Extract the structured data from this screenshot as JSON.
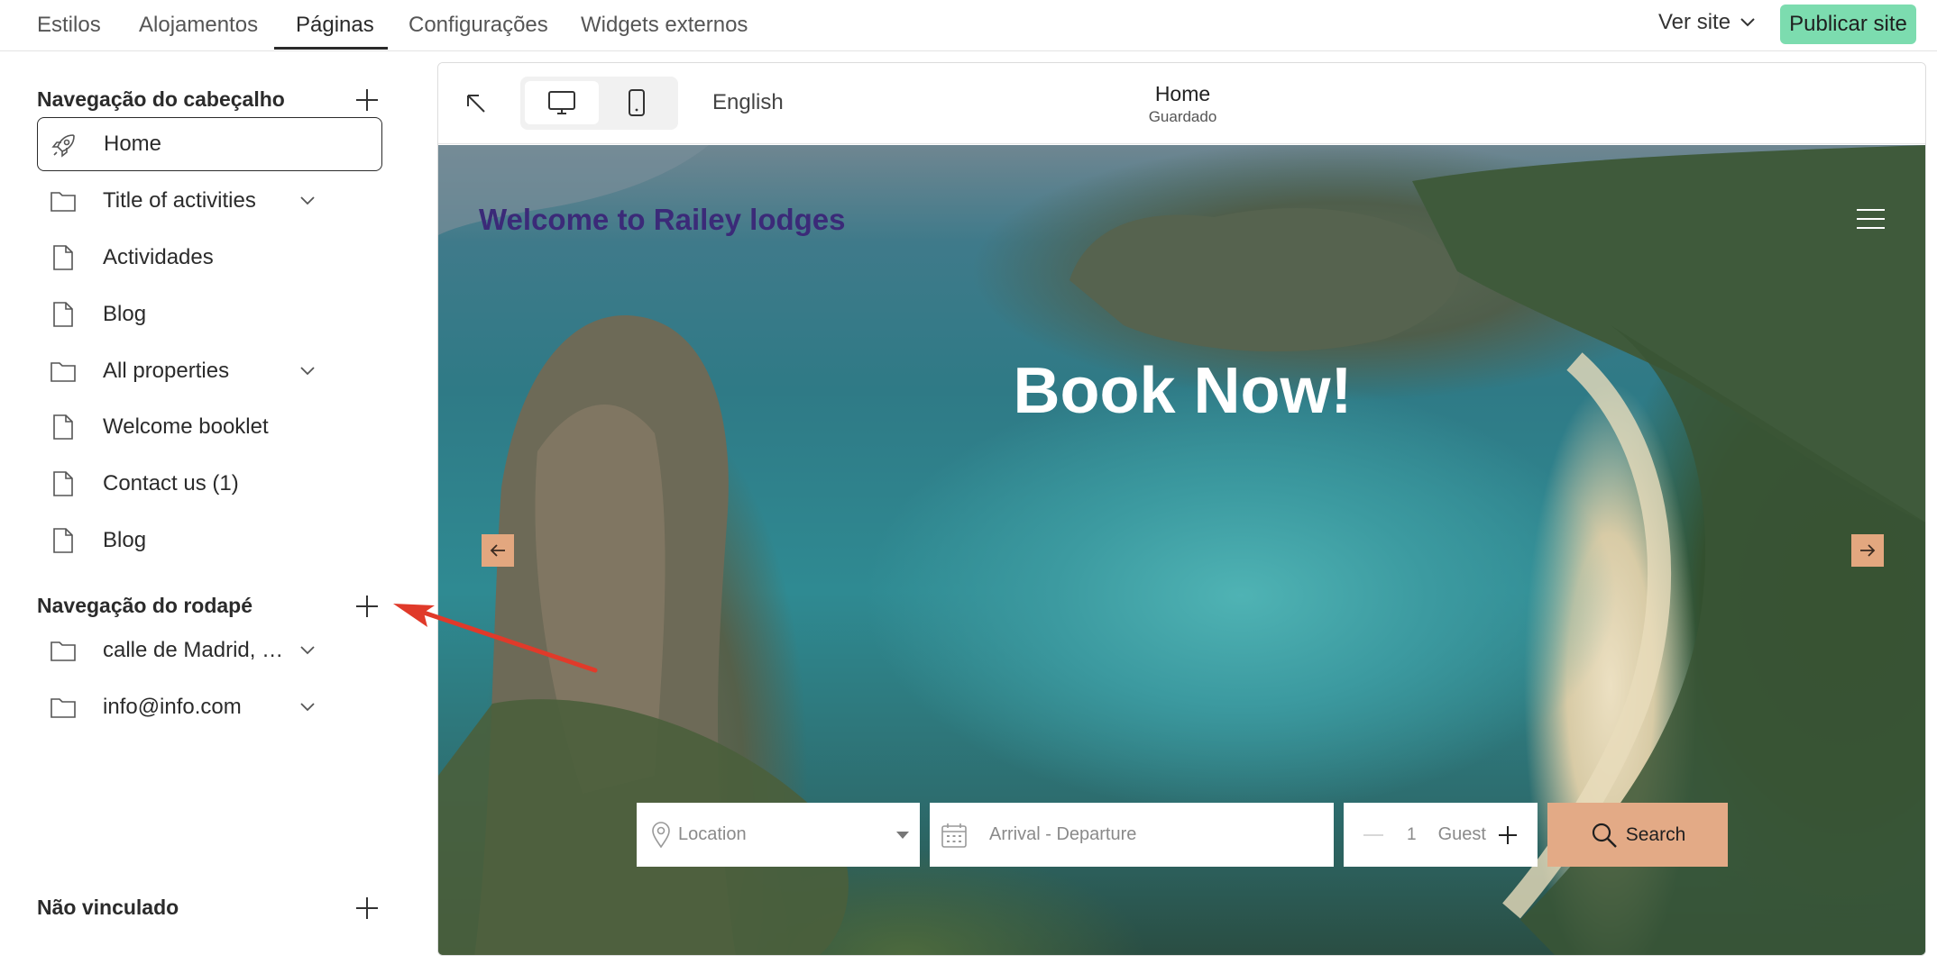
{
  "tabs": [
    {
      "label": "Estilos"
    },
    {
      "label": "Alojamentos"
    },
    {
      "label": "Páginas"
    },
    {
      "label": "Configurações"
    },
    {
      "label": "Widgets externos"
    }
  ],
  "header": {
    "view_site": "Ver site",
    "publish": "Publicar site"
  },
  "sidebar": {
    "header_nav": {
      "title": "Navegação do cabeçalho",
      "items": [
        {
          "label": "Home",
          "icon": "rocket-icon"
        },
        {
          "label": "Title of activities",
          "icon": "folder-icon"
        },
        {
          "label": "Actividades",
          "icon": "page-icon"
        },
        {
          "label": "Blog",
          "icon": "page-icon"
        },
        {
          "label": "All properties",
          "icon": "folder-icon"
        },
        {
          "label": "Welcome booklet",
          "icon": "page-icon"
        },
        {
          "label": "Contact us (1)",
          "icon": "page-icon"
        },
        {
          "label": "Blog",
          "icon": "page-icon"
        }
      ]
    },
    "footer_nav": {
      "title": "Navegação do rodapé",
      "items": [
        {
          "label": "calle de Madrid, …",
          "icon": "folder-icon"
        },
        {
          "label": "info@info.com",
          "icon": "folder-icon"
        }
      ]
    },
    "unlinked": {
      "title": "Não vinculado"
    }
  },
  "preview": {
    "language": "English",
    "page_title": "Home",
    "page_status": "Guardado",
    "hero": {
      "welcome": "Welcome to Railey lodges",
      "headline": "Book Now!"
    },
    "search": {
      "location_placeholder": "Location",
      "dates_placeholder": "Arrival - Departure",
      "guest_count": "1",
      "guest_label": "Guest",
      "search_label": "Search"
    }
  },
  "colors": {
    "publish": "#7cdcaf",
    "accent": "#e3aa86",
    "welcome_text": "#3b2a78",
    "annotation_arrow": "#e03a2a"
  }
}
